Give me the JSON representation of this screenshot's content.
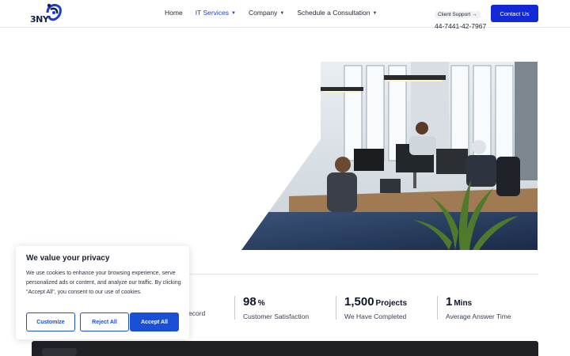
{
  "brand": {
    "logo_text": "3NY"
  },
  "nav": {
    "items": [
      {
        "label": "Home",
        "has_caret": false,
        "active": false
      },
      {
        "label": "IT Services",
        "has_caret": true,
        "active": true
      },
      {
        "label": "Company",
        "has_caret": true,
        "active": false
      },
      {
        "label": "Schedule a Consultation",
        "has_caret": true,
        "active": false
      }
    ]
  },
  "header": {
    "support_label": "Client Support →",
    "phone": "44-7441-42-7967",
    "contact_button": "Contact Us"
  },
  "stats": {
    "partial_label": "ecord",
    "items": [
      {
        "value": "98",
        "unit": "%",
        "label": "Customer Satisfaction"
      },
      {
        "value": "1,500",
        "unit": "Projects",
        "label": "We Have Completed"
      },
      {
        "value": "1",
        "unit": "Mins",
        "label": "Average Answer Time"
      }
    ]
  },
  "cookie": {
    "title": "We value your privacy",
    "text": "We use cookies to enhance your browsing experience, serve personalized ads or content, and analyze our traffic. By clicking \"Accept All\", you consent to our use of cookies.",
    "customize": "Customize",
    "reject": "Reject All",
    "accept": "Accept All"
  },
  "colors": {
    "accent": "#1429d6",
    "cookie_button": "#1a4fd6",
    "active_nav": "#1d3fcf",
    "dark_band": "#1f2125"
  }
}
